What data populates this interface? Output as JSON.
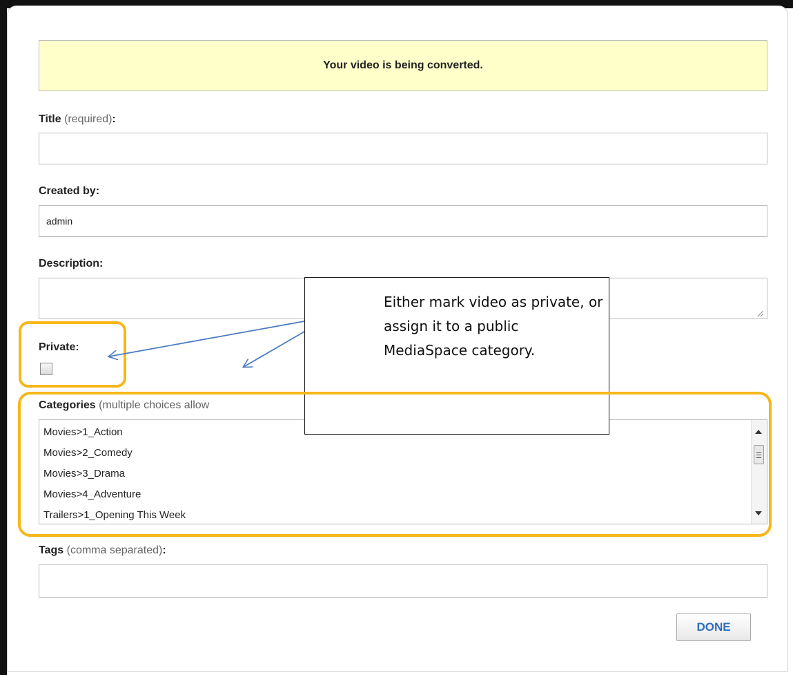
{
  "notice": "Your video is being converted.",
  "title_field": {
    "label": "Title",
    "hint": "(required)",
    "colon": ":",
    "value": ""
  },
  "created_by": {
    "label": "Created by:",
    "value": "admin"
  },
  "description": {
    "label": "Description:",
    "value": ""
  },
  "private": {
    "label": "Private:",
    "checked": false
  },
  "categories": {
    "label": "Categories",
    "hint": "(multiple choices allow",
    "options": [
      "Movies>1_Action",
      "Movies>2_Comedy",
      "Movies>3_Drama",
      "Movies>4_Adventure",
      "Trailers>1_Opening This Week"
    ]
  },
  "tags": {
    "label": "Tags",
    "hint": "(comma separated)",
    "colon": ":",
    "value": ""
  },
  "done_button": "DONE",
  "callout": "Either mark video as private, or assign it to a public MediaSpace category.",
  "colors": {
    "notice_bg": "#ffffc9",
    "highlight": "#f5b71a",
    "arrow": "#4a7cc0",
    "done_text": "#2b6cc4"
  }
}
